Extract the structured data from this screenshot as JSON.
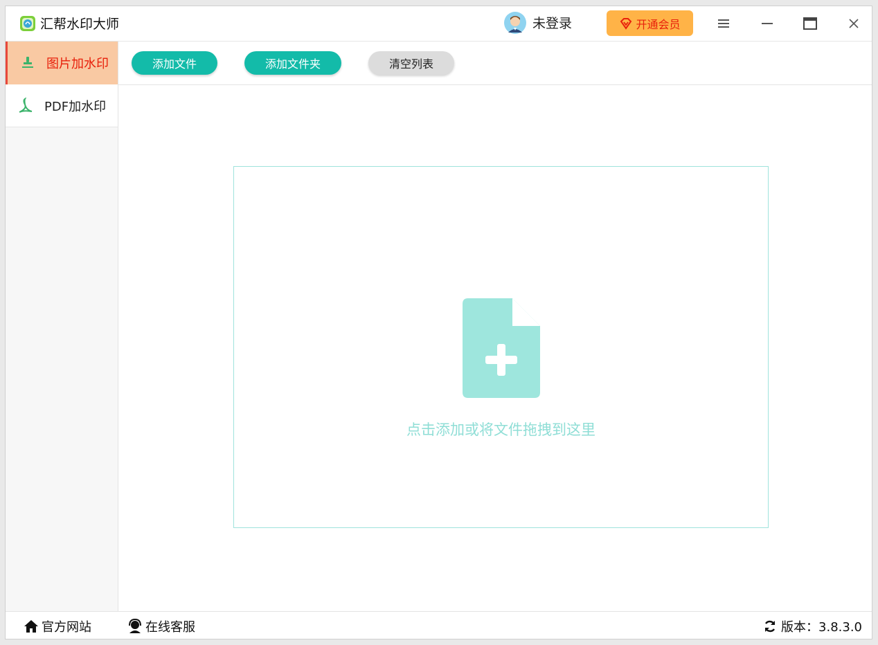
{
  "app": {
    "title": "汇帮水印大师"
  },
  "header": {
    "login_text": "未登录",
    "vip_label": "开通会员"
  },
  "sidebar": {
    "items": [
      {
        "label": "图片加水印",
        "icon": "stamp-icon",
        "active": true
      },
      {
        "label": "PDF加水印",
        "icon": "pdf-icon",
        "active": false
      }
    ]
  },
  "toolbar": {
    "add_file": "添加文件",
    "add_folder": "添加文件夹",
    "clear_list": "清空列表"
  },
  "dropzone": {
    "hint": "点击添加或将文件拖拽到这里"
  },
  "statusbar": {
    "website": "官方网站",
    "support": "在线客服",
    "version": "版本：3.8.3.0"
  },
  "colors": {
    "accent_green": "#13bba9",
    "active_tab_bg": "#f9c9a3",
    "active_tab_text": "#e8200b",
    "vip_bg": "#ffb347",
    "dropzone_border": "#9fe3dc",
    "drop_icon": "#9ee6dd"
  }
}
